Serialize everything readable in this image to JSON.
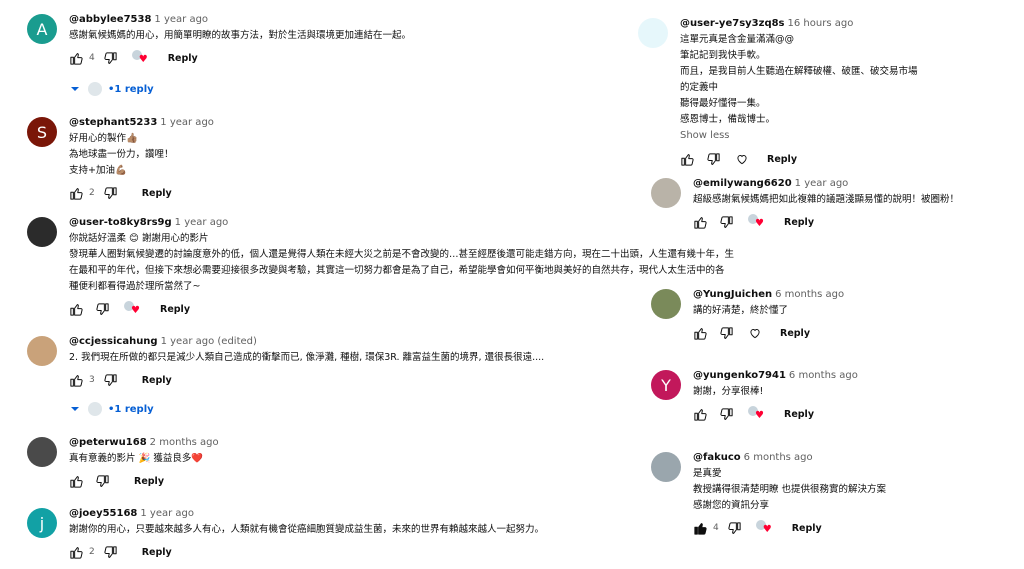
{
  "left": [
    {
      "author": "@abbylee7538",
      "time": "1 year ago",
      "avatar": {
        "letter": "A",
        "color": "#1a9c8f"
      },
      "lines": [
        "感謝氣候媽媽的用心，用簡單明瞭的故事方法，對於生活與環境更加連結在一起。"
      ],
      "likes": "4",
      "creator_heart": true,
      "reply": "Reply",
      "replies": "1 reply"
    },
    {
      "author": "@stephant5233",
      "time": "1 year ago",
      "avatar": {
        "letter": "S",
        "color": "#7a1608"
      },
      "lines": [
        "好用心的製作👍🏽",
        "為地球盡一份力，讚哩！",
        "支持+加油💪🏽"
      ],
      "likes": "2",
      "creator_heart": false,
      "reply": "Reply"
    },
    {
      "author": "@user-to8ky8rs9g",
      "time": "1 year ago",
      "avatar": {
        "letter": "",
        "color": "#2b2b2b"
      },
      "lines": [
        "你說話好溫柔 😊 謝謝用心的影片",
        "發現華人圈對氣候變遷的討論度意外的低，個人還是覺得人類在未經大災之前是不會改變的…甚至經歷後還可能走錯方向，現在二十出頭，人生還有幾十年，生",
        "在最和平的年代，但接下來想必需要迎接很多改變與考驗，其實這一切努力都會是為了自己，希望能學會如何平衡地與美好的自然共存，現代人太生活中的各",
        "種便利都看得過於理所當然了~"
      ],
      "likes": "",
      "creator_heart": true,
      "reply": "Reply"
    },
    {
      "author": "@ccjessicahung",
      "time": "1 year ago (edited)",
      "avatar": {
        "letter": "",
        "color": "#c9a27a"
      },
      "lines": [
        "2.  我們現在所做的都只是減少人類自己造成的衝擊而已, 像淨灘, 種樹, 環保3R. 離富益生菌的境界, 還很長很遠...."
      ],
      "likes": "3",
      "creator_heart": false,
      "reply": "Reply",
      "replies": "1 reply"
    },
    {
      "author": "@peterwu168",
      "time": "2 months ago",
      "avatar": {
        "letter": "",
        "color": "#4a4a4a"
      },
      "lines": [
        "真有意義的影片 🎉 獲益良多❤️"
      ],
      "likes": "",
      "creator_heart": false,
      "reply": "Reply"
    },
    {
      "author": "@joey55168",
      "time": "1 year ago",
      "avatar": {
        "letter": "j",
        "color": "#12a1a5"
      },
      "lines": [
        "謝謝你的用心，只要越來越多人有心，人類就有機會從癌細胞質變成益生菌，未來的世界有賴越來越人一起努力。"
      ],
      "likes": "2",
      "creator_heart": false,
      "reply": "Reply"
    }
  ],
  "right": [
    {
      "author": "@user-ye7sy3zq8s",
      "time": "16 hours ago",
      "avatar": {
        "letter": "",
        "color": "#e6f7fb"
      },
      "lines": [
        "這單元真是含金量滿滿@@",
        "筆記記到我快手軟。",
        "而且，是我目前人生聽過在解釋破權、破匯、破交易市場",
        "的定義中",
        "聽得最好懂得一集。",
        "感恩博士，備哉博士。"
      ],
      "show_less": "Show less",
      "likes": "",
      "creator_heart": false,
      "reply": "Reply"
    },
    {
      "author": "@emilywang6620",
      "time": "1 year ago",
      "avatar": {
        "letter": "",
        "color": "#b9b3a8"
      },
      "lines": [
        "超級感謝氣候媽媽把如此複雜的議題淺顯易懂的說明！被圈粉！"
      ],
      "likes": "",
      "creator_heart": true,
      "reply": "Reply"
    },
    {
      "author": "@YungJuichen",
      "time": "6 months ago",
      "avatar": {
        "letter": "",
        "color": "#7a8a5a"
      },
      "lines": [
        "講的好清楚，終於懂了"
      ],
      "likes": "",
      "creator_heart": false,
      "reply": "Reply"
    },
    {
      "author": "@yungenko7941",
      "time": "6 months ago",
      "avatar": {
        "letter": "Y",
        "color": "#c2185b"
      },
      "lines": [
        "謝謝，分享很棒!"
      ],
      "likes": "",
      "creator_heart": true,
      "reply": "Reply"
    },
    {
      "author": "@fakuco",
      "time": "6 months ago",
      "avatar": {
        "letter": "",
        "color": "#9aa6ad"
      },
      "lines": [
        "是真愛",
        "教授講得很清楚明瞭 也提供很務實的解決方案",
        "感謝您的資訊分享"
      ],
      "likes": "4",
      "liked": true,
      "creator_heart": true,
      "reply": "Reply"
    }
  ]
}
